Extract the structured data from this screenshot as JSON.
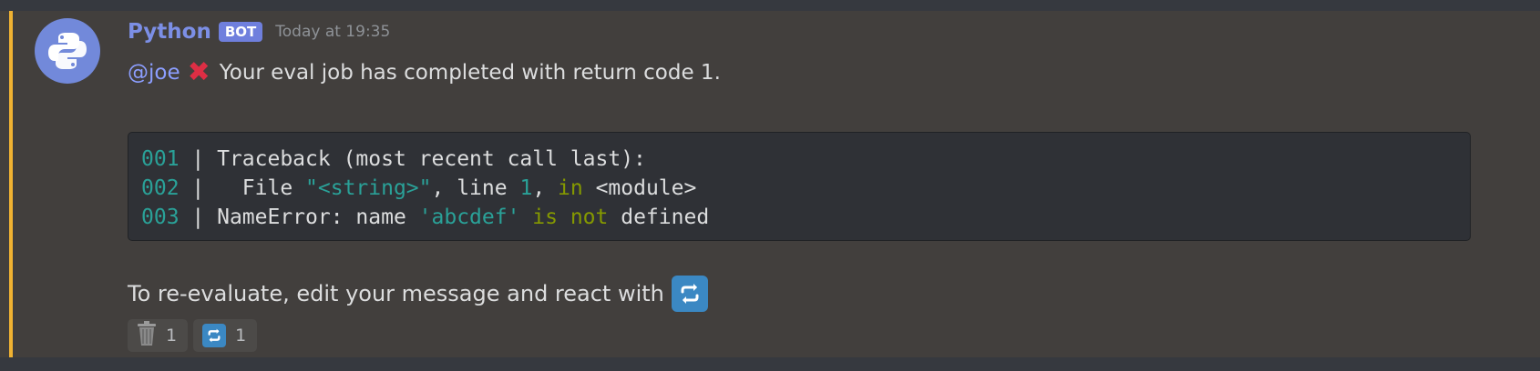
{
  "message": {
    "author": "Python",
    "bot_tag": "BOT",
    "timestamp": "Today at 19:35",
    "mention": "@joe",
    "status_text": "Your eval job has completed with return code 1.",
    "accent_color": "#f0b232",
    "avatar_icon": "python-logo-icon",
    "status_icon": "cross-mark-icon"
  },
  "code": {
    "lines": [
      {
        "num": "001",
        "sep": " | ",
        "parts": [
          {
            "t": "Traceback (most recent call last):",
            "c": "plain"
          }
        ]
      },
      {
        "num": "002",
        "sep": " | ",
        "parts": [
          {
            "t": "  File ",
            "c": "plain"
          },
          {
            "t": "\"<string>\"",
            "c": "str"
          },
          {
            "t": ", line ",
            "c": "plain"
          },
          {
            "t": "1",
            "c": "num"
          },
          {
            "t": ", ",
            "c": "plain"
          },
          {
            "t": "in",
            "c": "kw"
          },
          {
            "t": " <module>",
            "c": "plain"
          }
        ]
      },
      {
        "num": "003",
        "sep": " | ",
        "parts": [
          {
            "t": "NameError: name ",
            "c": "plain"
          },
          {
            "t": "'abcdef'",
            "c": "str"
          },
          {
            "t": " ",
            "c": "plain"
          },
          {
            "t": "is not",
            "c": "kw"
          },
          {
            "t": " defined",
            "c": "plain"
          }
        ]
      }
    ]
  },
  "footer": {
    "text": "To re-evaluate, edit your message and react with",
    "emoji": "repeat-icon"
  },
  "reactions": [
    {
      "icon": "wastebasket-icon",
      "count": "1"
    },
    {
      "icon": "repeat-icon",
      "count": "1"
    }
  ]
}
